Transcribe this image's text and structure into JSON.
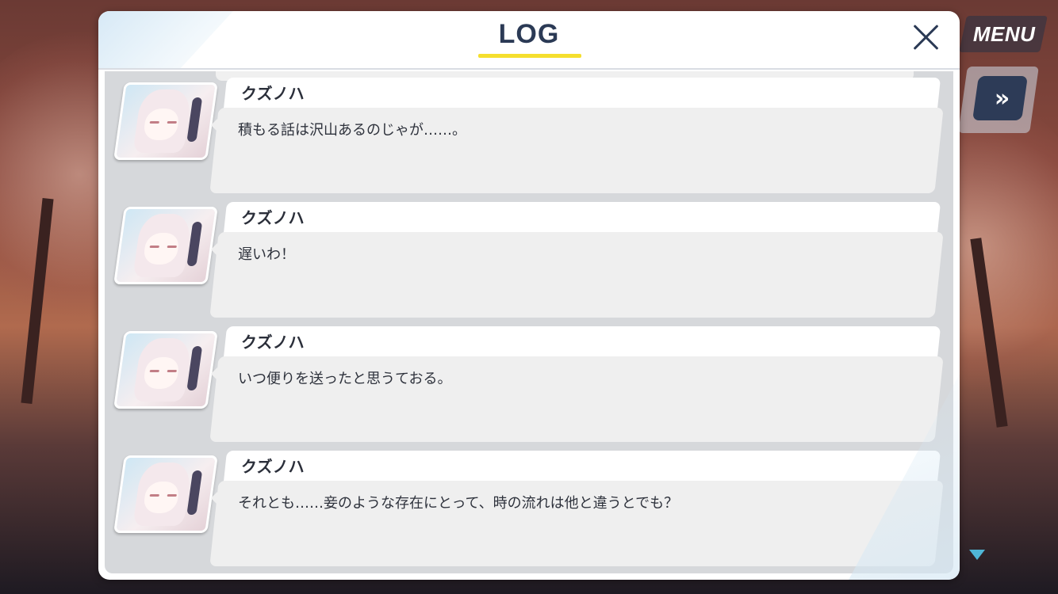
{
  "log": {
    "title": "LOG",
    "entries": [
      {
        "speaker": "クズノハ",
        "text": "積もる話は沢山あるのじゃが……。"
      },
      {
        "speaker": "クズノハ",
        "text": "遅いわ！"
      },
      {
        "speaker": "クズノハ",
        "text": "いつ便りを送ったと思うておる。"
      },
      {
        "speaker": "クズノハ",
        "text": "それとも……妾のような存在にとって、時の流れは他と違うとでも？"
      }
    ]
  },
  "controls": {
    "menu_label": "MENU",
    "fast_forward_label": "»"
  },
  "icons": {
    "close": "close-icon",
    "fast_forward": "fast-forward-icon",
    "scroll_down": "triangle-down-icon"
  },
  "colors": {
    "title_underline": "#f5df2e",
    "title_text": "#2b3a55",
    "ff_button": "#2d3b57",
    "scroll_arrow": "#4fb6d6"
  }
}
